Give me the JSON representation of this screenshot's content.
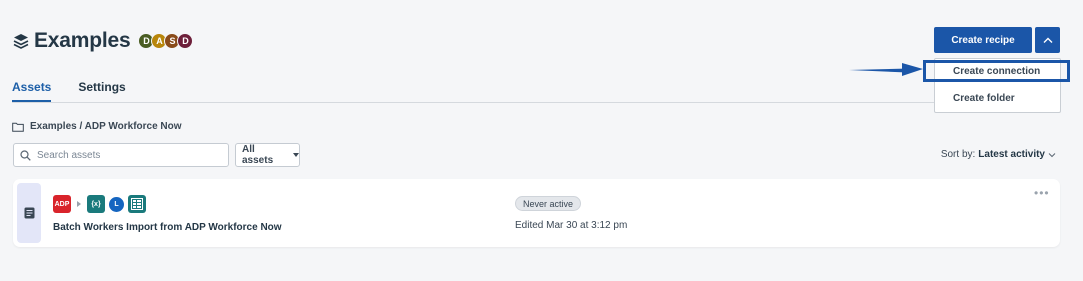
{
  "header": {
    "title": "Examples",
    "avatars": [
      {
        "letter": "D",
        "color": "#4a5d23"
      },
      {
        "letter": "A",
        "color": "#b8860b"
      },
      {
        "letter": "S",
        "color": "#8a4b1a"
      },
      {
        "letter": "D",
        "color": "#6d1f3a"
      }
    ]
  },
  "tabs": [
    {
      "label": "Assets",
      "active": true
    },
    {
      "label": "Settings",
      "active": false
    }
  ],
  "breadcrumb": "Examples / ADP Workforce Now",
  "search": {
    "placeholder": "Search assets",
    "value": ""
  },
  "filter": {
    "label": "All assets"
  },
  "sort": {
    "prefix": "Sort by:",
    "value": "Latest activity"
  },
  "actions": {
    "create_recipe": "Create recipe",
    "menu_items": [
      "Create connection",
      "Create folder"
    ]
  },
  "recipe": {
    "name": "Batch Workers Import from ADP Workforce Now",
    "status": "Never active",
    "edited": "Edited Mar 30 at 3:12 pm",
    "apps": [
      {
        "icon": "adp-icon",
        "label": "ADP",
        "color": "#d9242b"
      },
      {
        "icon": "variables-icon",
        "label": "{x}",
        "color": "#1a7a7c"
      },
      {
        "icon": "logger-icon",
        "label": "L",
        "color": "#1565c0"
      },
      {
        "icon": "table-icon",
        "label": "",
        "color": "#1a7a7c"
      }
    ]
  },
  "colors": {
    "accent": "#1b56a8",
    "background": "#f5f6f8"
  }
}
